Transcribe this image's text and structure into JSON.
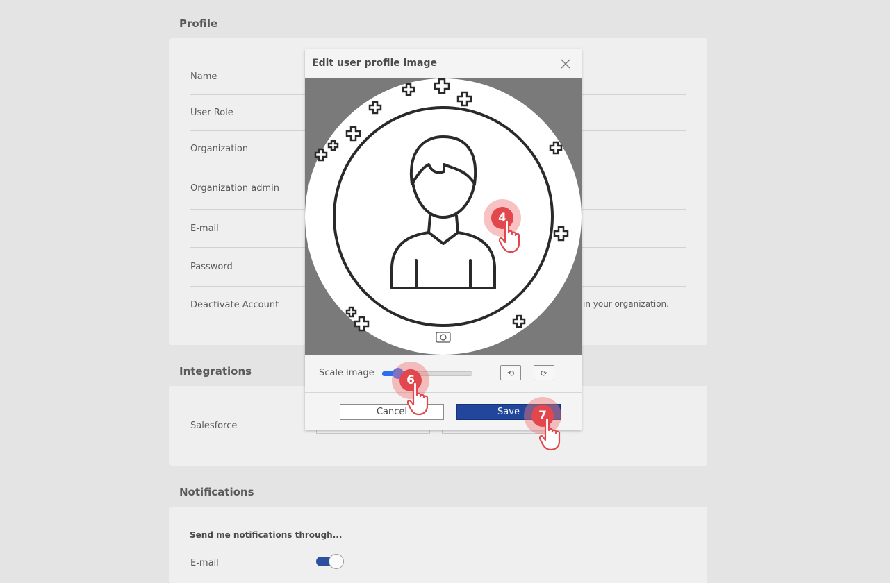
{
  "profile": {
    "title": "Profile",
    "rows": [
      {
        "label": "Name"
      },
      {
        "label": "User Role"
      },
      {
        "label": "Organization"
      },
      {
        "label": "Organization admin"
      },
      {
        "label": "E-mail"
      },
      {
        "label": "Password"
      },
      {
        "label": "Deactivate Account"
      }
    ],
    "deactivate_note": "in your organization."
  },
  "integrations": {
    "title": "Integrations",
    "salesforce_label": "Salesforce"
  },
  "notifications": {
    "title": "Notifications",
    "subtitle": "Send me notifications through...",
    "email_label": "E-mail",
    "email_enabled": true
  },
  "modal": {
    "title": "Edit user profile image",
    "scale_label": "Scale image",
    "scale_value": 0.18,
    "rotate_left_icon": "rotate-ccw-icon",
    "rotate_right_icon": "rotate-cw-icon",
    "cancel_label": "Cancel",
    "save_label": "Save"
  },
  "markers": [
    {
      "number": "4"
    },
    {
      "number": "6"
    },
    {
      "number": "7"
    }
  ],
  "colors": {
    "accent": "#21469b",
    "slider": "#2b6ef2",
    "marker": "#e2474d"
  }
}
